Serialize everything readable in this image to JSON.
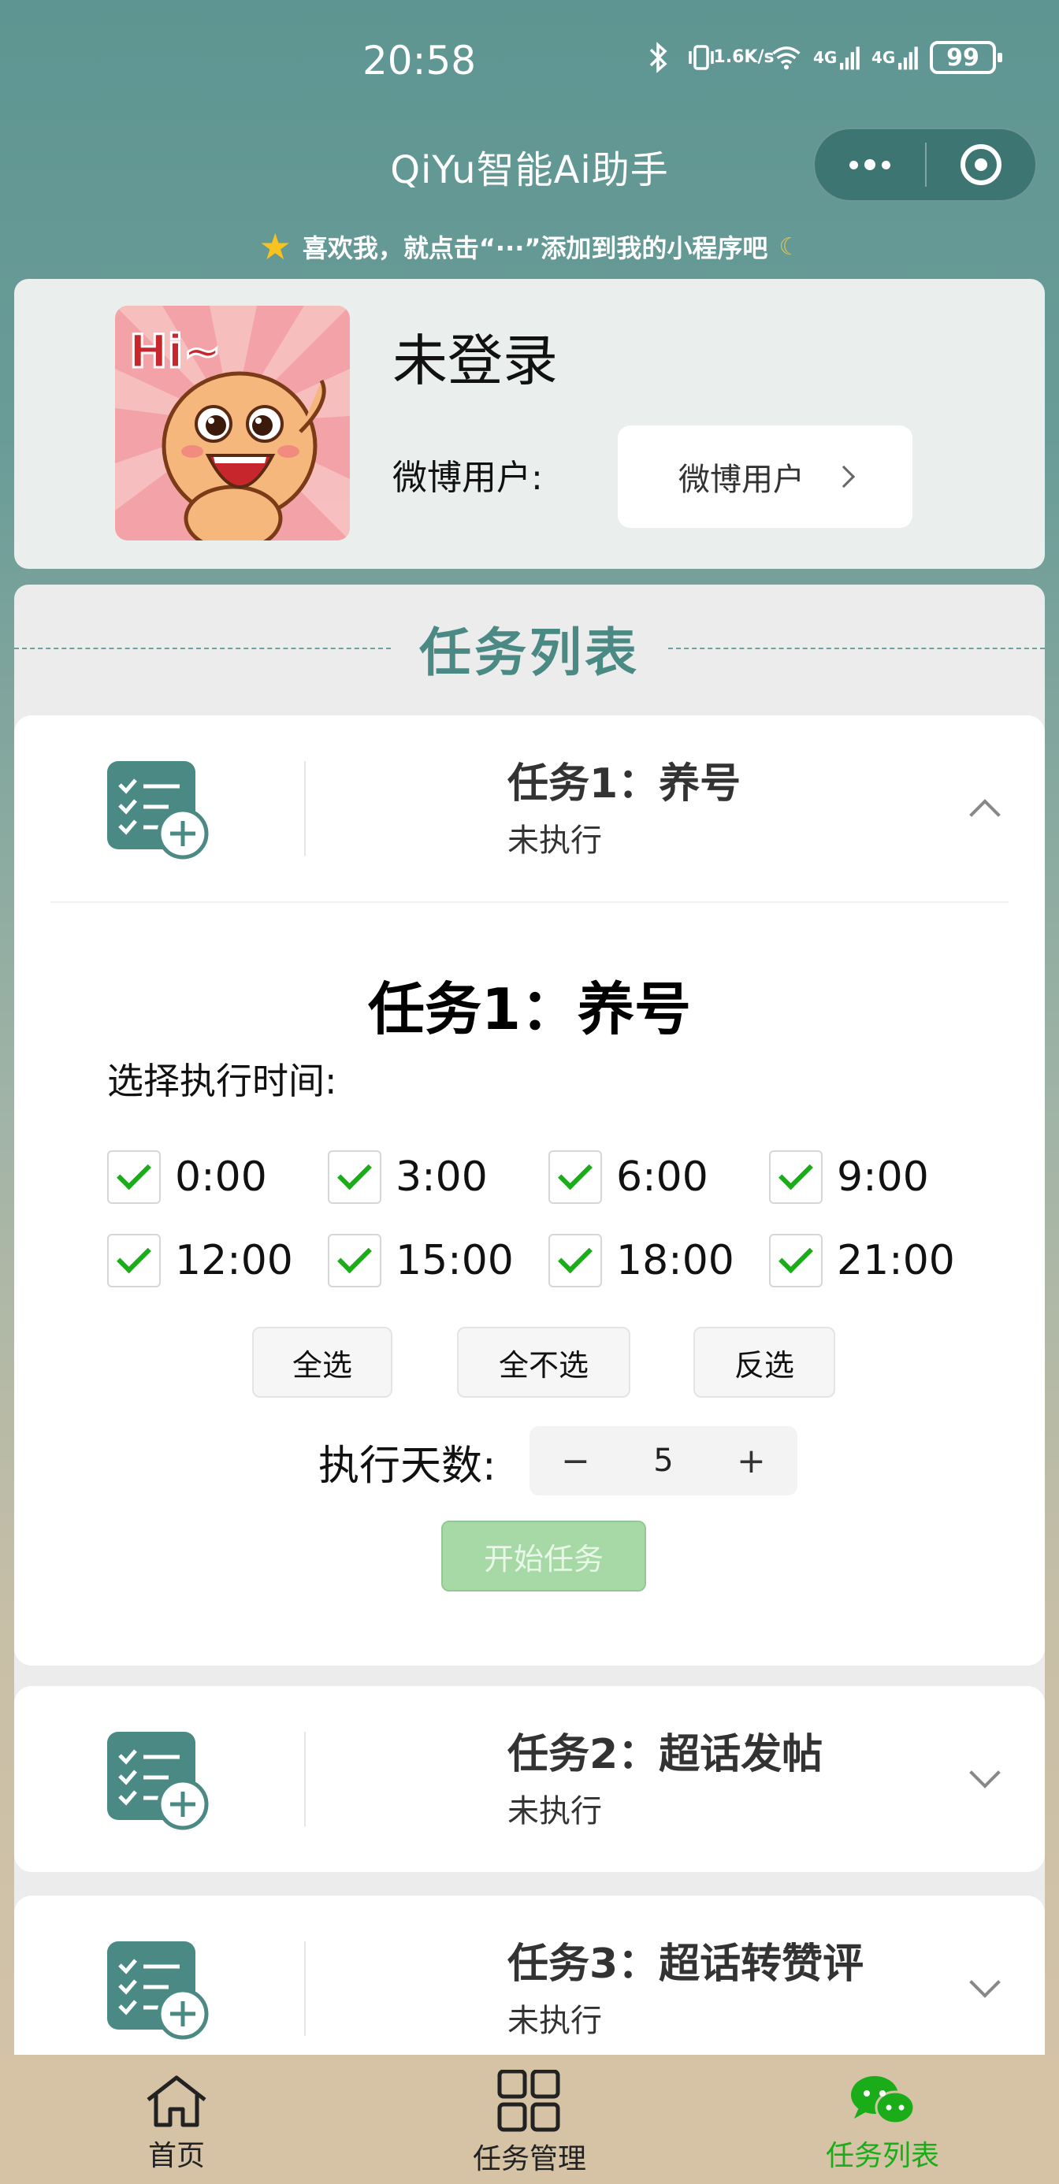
{
  "status_bar": {
    "time": "20:58",
    "net_speed_top": "1.6",
    "net_speed_bottom": "K/s",
    "signal1": "4G",
    "signal2": "4G",
    "battery": "99"
  },
  "nav": {
    "title": "QiYu智能Ai助手"
  },
  "tip": {
    "text": "喜欢我，就点击“···”添加到我的小程序吧"
  },
  "profile": {
    "login_status": "未登录",
    "weibo_label": "微博用户:",
    "weibo_button": "微博用户"
  },
  "task_section": {
    "title": "任务列表",
    "tasks": [
      {
        "name": "任务1：养号",
        "status": "未执行",
        "expanded": true,
        "detail": {
          "title": "任务1：养号",
          "subtitle": "选择执行时间:",
          "times": [
            {
              "label": "0:00",
              "checked": true
            },
            {
              "label": "3:00",
              "checked": true
            },
            {
              "label": "6:00",
              "checked": true
            },
            {
              "label": "9:00",
              "checked": true
            },
            {
              "label": "12:00",
              "checked": true
            },
            {
              "label": "15:00",
              "checked": true
            },
            {
              "label": "18:00",
              "checked": true
            },
            {
              "label": "21:00",
              "checked": true
            }
          ],
          "select_all": "全选",
          "select_none": "全不选",
          "invert": "反选",
          "days_label": "执行天数:",
          "days_minus": "−",
          "days_value": "5",
          "days_plus": "+",
          "start_button": "开始任务"
        }
      },
      {
        "name": "任务2：超话发帖",
        "status": "未执行",
        "expanded": false
      },
      {
        "name": "任务3：超话转赞评",
        "status": "未执行",
        "expanded": false
      }
    ]
  },
  "tab_bar": {
    "items": [
      {
        "label": "首页",
        "icon": "home-icon",
        "active": false
      },
      {
        "label": "任务管理",
        "icon": "grid-icon",
        "active": false
      },
      {
        "label": "任务列表",
        "icon": "chat-icon",
        "active": true
      }
    ]
  },
  "colors": {
    "accent": "#4b8985",
    "active_tab": "#1aad19",
    "start_button": "#a7d9a6"
  }
}
